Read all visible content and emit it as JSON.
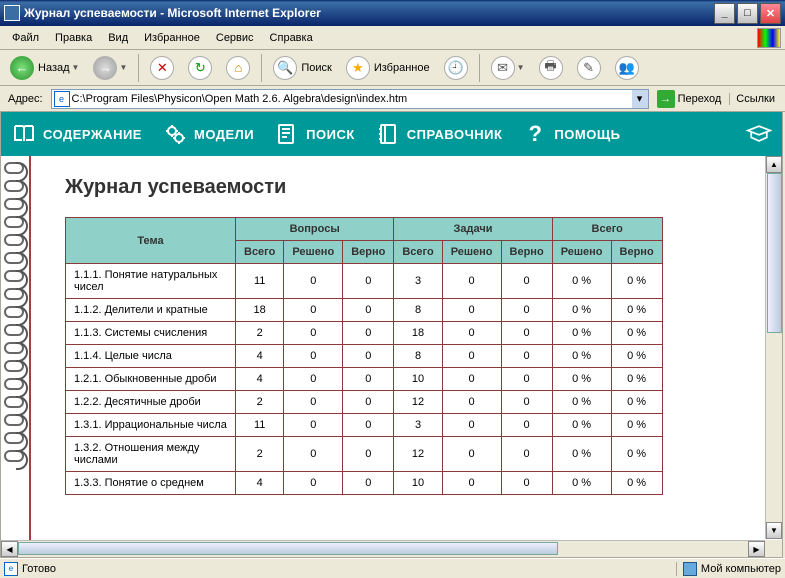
{
  "window": {
    "title": "Журнал успеваемости - Microsoft Internet Explorer"
  },
  "menu": {
    "file": "Файл",
    "edit": "Правка",
    "view": "Вид",
    "favorites": "Избранное",
    "tools": "Сервис",
    "help": "Справка"
  },
  "toolbar": {
    "back": "Назад",
    "search": "Поиск",
    "favorites": "Избранное"
  },
  "address": {
    "label": "Адрес:",
    "value": "C:\\Program Files\\Physicon\\Open Math 2.6. Algebra\\design\\index.htm",
    "go": "Переход",
    "links": "Ссылки"
  },
  "app_toolbar": {
    "contents": "СОДЕРЖАНИЕ",
    "models": "МОДЕЛИ",
    "search": "ПОИСК",
    "reference": "СПРАВОЧНИК",
    "help": "ПОМОЩЬ"
  },
  "page": {
    "heading": "Журнал успеваемости",
    "headers": {
      "topic": "Тема",
      "questions": "Вопросы",
      "tasks": "Задачи",
      "total": "Всего",
      "all": "Всего",
      "solved": "Решено",
      "correct": "Верно"
    },
    "rows": [
      {
        "topic": "1.1.1. Понятие натуральных чисел",
        "q_all": "11",
        "q_solved": "0",
        "q_correct": "0",
        "t_all": "3",
        "t_solved": "0",
        "t_correct": "0",
        "tot_solved": "0 %",
        "tot_correct": "0 %"
      },
      {
        "topic": "1.1.2. Делители и кратные",
        "q_all": "18",
        "q_solved": "0",
        "q_correct": "0",
        "t_all": "8",
        "t_solved": "0",
        "t_correct": "0",
        "tot_solved": "0 %",
        "tot_correct": "0 %"
      },
      {
        "topic": "1.1.3. Системы счисления",
        "q_all": "2",
        "q_solved": "0",
        "q_correct": "0",
        "t_all": "18",
        "t_solved": "0",
        "t_correct": "0",
        "tot_solved": "0 %",
        "tot_correct": "0 %"
      },
      {
        "topic": "1.1.4. Целые числа",
        "q_all": "4",
        "q_solved": "0",
        "q_correct": "0",
        "t_all": "8",
        "t_solved": "0",
        "t_correct": "0",
        "tot_solved": "0 %",
        "tot_correct": "0 %"
      },
      {
        "topic": "1.2.1. Обыкновенные дроби",
        "q_all": "4",
        "q_solved": "0",
        "q_correct": "0",
        "t_all": "10",
        "t_solved": "0",
        "t_correct": "0",
        "tot_solved": "0 %",
        "tot_correct": "0 %"
      },
      {
        "topic": "1.2.2. Десятичные дроби",
        "q_all": "2",
        "q_solved": "0",
        "q_correct": "0",
        "t_all": "12",
        "t_solved": "0",
        "t_correct": "0",
        "tot_solved": "0 %",
        "tot_correct": "0 %"
      },
      {
        "topic": "1.3.1. Иррациональные числа",
        "q_all": "11",
        "q_solved": "0",
        "q_correct": "0",
        "t_all": "3",
        "t_solved": "0",
        "t_correct": "0",
        "tot_solved": "0 %",
        "tot_correct": "0 %"
      },
      {
        "topic": "1.3.2. Отношения между числами",
        "q_all": "2",
        "q_solved": "0",
        "q_correct": "0",
        "t_all": "12",
        "t_solved": "0",
        "t_correct": "0",
        "tot_solved": "0 %",
        "tot_correct": "0 %"
      },
      {
        "topic": "1.3.3. Понятие о среднем",
        "q_all": "4",
        "q_solved": "0",
        "q_correct": "0",
        "t_all": "10",
        "t_solved": "0",
        "t_correct": "0",
        "tot_solved": "0 %",
        "tot_correct": "0 %"
      }
    ]
  },
  "status": {
    "ready": "Готово",
    "zone": "Мой компьютер"
  }
}
